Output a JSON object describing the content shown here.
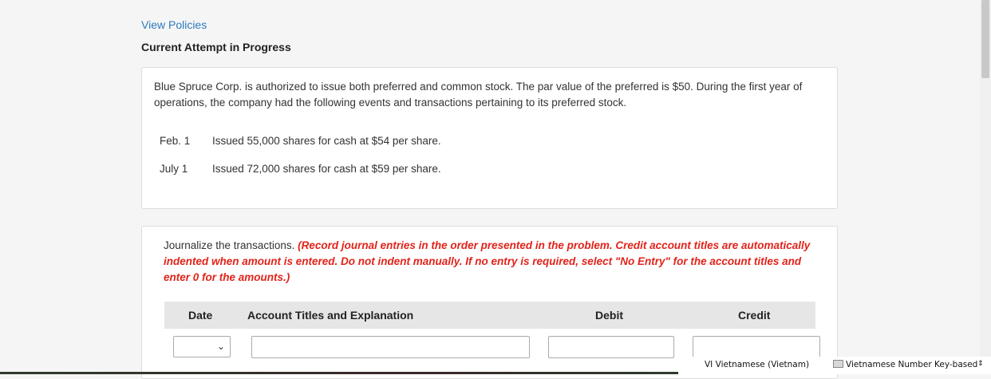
{
  "header": {
    "view_policies": "View Policies",
    "attempt_status": "Current Attempt in Progress"
  },
  "problem": {
    "text": "Blue Spruce Corp. is authorized to issue both preferred and common stock. The par value of the preferred is $50. During the first year of operations, the company had the following events and transactions pertaining to its preferred stock.",
    "transactions": [
      {
        "date": "Feb. 1",
        "description": "Issued 55,000 shares for cash at $54 per share."
      },
      {
        "date": "July 1",
        "description": "Issued 72,000 shares for cash at $59 per share."
      }
    ]
  },
  "journal": {
    "instruction_plain": "Journalize the transactions. ",
    "instruction_red": "(Record journal entries in the order presented in the problem. Credit account titles are automatically indented when amount is entered. Do not indent manually. If no entry is required, select \"No Entry\" for the account titles and enter 0 for the amounts.)",
    "columns": {
      "date": "Date",
      "account": "Account Titles and Explanation",
      "debit": "Debit",
      "credit": "Credit"
    },
    "row1": {
      "date_value": "",
      "account_value": "",
      "debit_value": "",
      "credit_value": ""
    }
  },
  "taskbar": {
    "language": "VI Vietnamese (Vietnam)",
    "keyboard": "Vietnamese Number Key-based"
  }
}
